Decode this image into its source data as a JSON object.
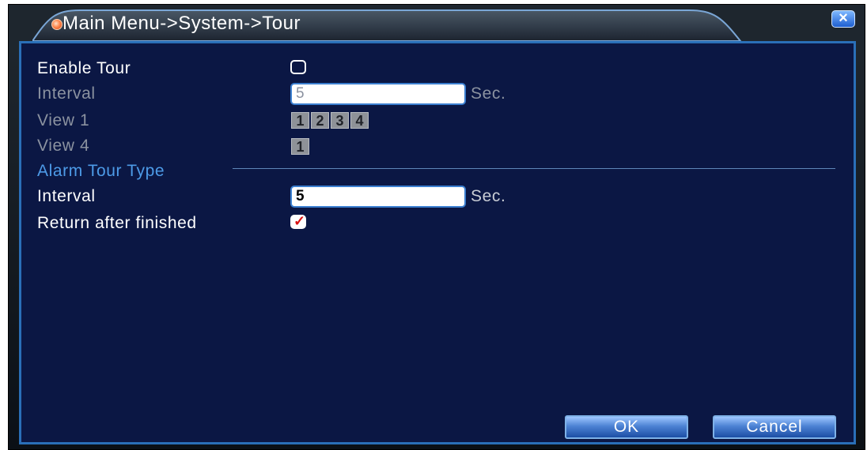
{
  "title": "Main Menu->System->Tour",
  "close_label": "×",
  "enable_tour": {
    "label": "Enable Tour",
    "checked": false
  },
  "interval": {
    "label": "Interval",
    "value": "5",
    "unit": "Sec."
  },
  "view1": {
    "label": "View 1",
    "chips": [
      "1",
      "2",
      "3",
      "4"
    ]
  },
  "view4": {
    "label": "View 4",
    "chips": [
      "1"
    ]
  },
  "alarm_section": {
    "heading": "Alarm Tour Type"
  },
  "alarm_interval": {
    "label": "Interval",
    "value": "5",
    "unit": "Sec."
  },
  "return_after": {
    "label": "Return after finished",
    "checked": true
  },
  "buttons": {
    "ok": "OK",
    "cancel": "Cancel"
  },
  "colors": {
    "panel_background": "#0b1744",
    "panel_border": "#2a6fb8",
    "section_heading": "#4d9be8",
    "disabled_text": "#8b92a0",
    "checkmark": "#d81010"
  },
  "icons": {
    "title_bullet": "orange-dot-icon",
    "close": "close-icon",
    "check": "checkmark-icon"
  }
}
